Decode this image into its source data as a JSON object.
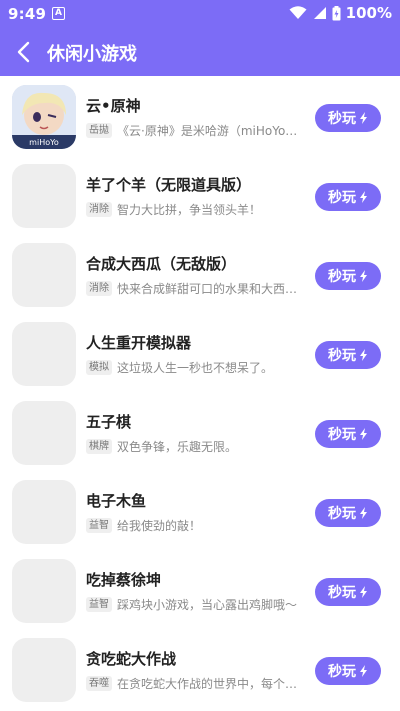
{
  "status": {
    "time": "9:49",
    "notif_icon": "A",
    "battery": "100%"
  },
  "header": {
    "title": "休闲小游戏"
  },
  "colors": {
    "accent": "#7c6cf6"
  },
  "games": [
    {
      "name": "云•原神",
      "tag": "岳拋",
      "desc": "《云·原神》是米哈游（miHoYo）...",
      "button": "秒玩",
      "thumb_text": "miHoYo"
    },
    {
      "name": "羊了个羊（无限道具版）",
      "tag": "消除",
      "desc": "智力大比拼，争当领头羊！",
      "button": "秒玩"
    },
    {
      "name": "合成大西瓜（无敌版）",
      "tag": "消除",
      "desc": "快来合成鲜甜可口的水果和大西瓜...",
      "button": "秒玩"
    },
    {
      "name": "人生重开模拟器",
      "tag": "模拟",
      "desc": "这垃圾人生一秒也不想呆了。",
      "button": "秒玩"
    },
    {
      "name": "五子棋",
      "tag": "棋牌",
      "desc": "双色争锋，乐趣无限。",
      "button": "秒玩"
    },
    {
      "name": "电子木鱼",
      "tag": "益智",
      "desc": "给我使劲的敲！",
      "button": "秒玩"
    },
    {
      "name": "吃掉蔡徐坤",
      "tag": "益智",
      "desc": "踩鸡块小游戏，当心露出鸡脚哦〜",
      "button": "秒玩"
    },
    {
      "name": "贪吃蛇大作战",
      "tag": "吞噬",
      "desc": "在贪吃蛇大作战的世界中，每个人...",
      "button": "秒玩"
    }
  ]
}
